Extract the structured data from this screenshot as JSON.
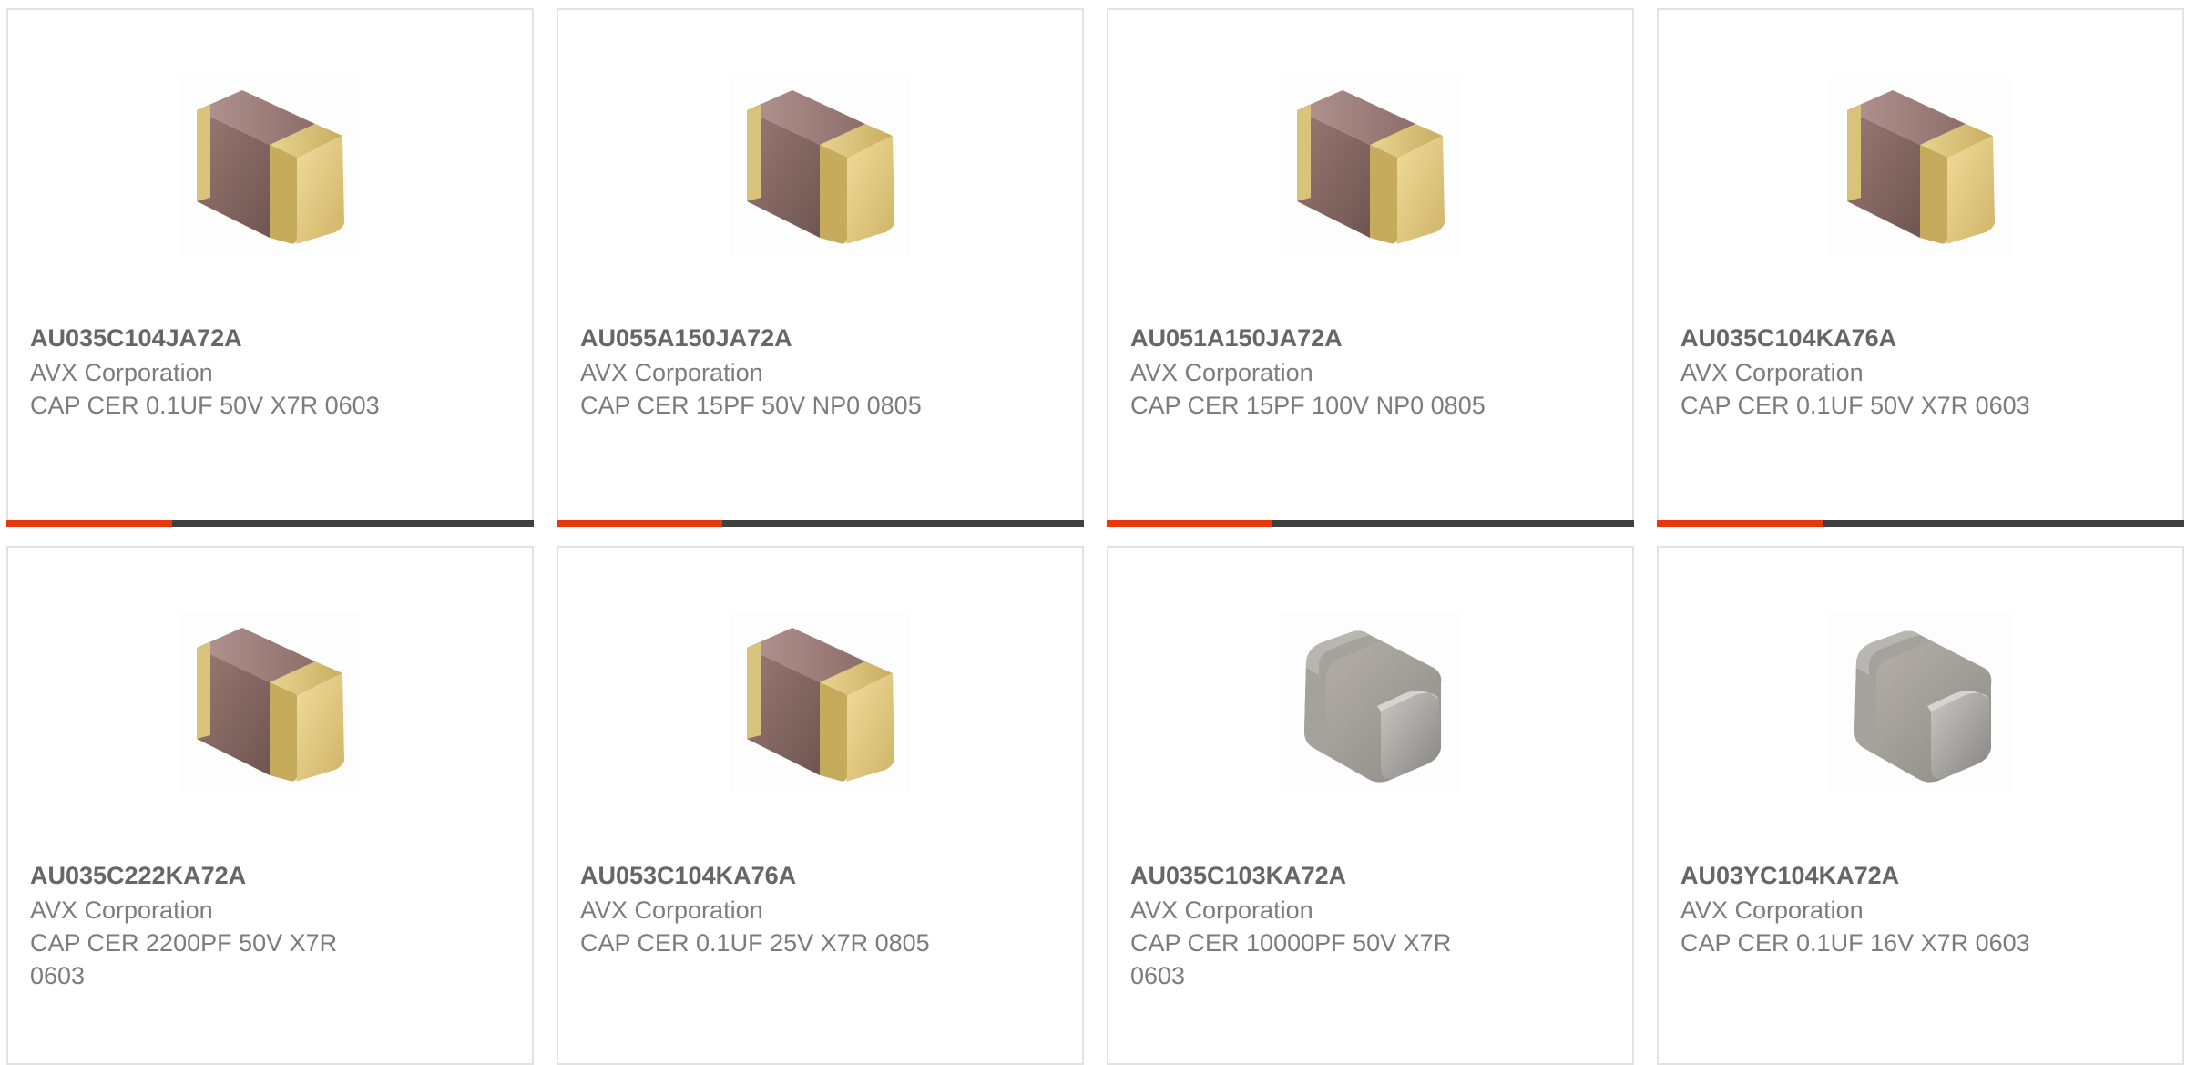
{
  "colors": {
    "accent_bar": "#e8360d",
    "dark_bar": "#404040",
    "border": "#e2e2e2",
    "part_text": "#666666",
    "body_text": "#7c7c7c"
  },
  "products": [
    {
      "part_number": "AU035C104JA72A",
      "manufacturer": "AVX Corporation",
      "description": "CAP CER 0.1UF 50V X7R 0603",
      "image": "capacitor-tan-icon",
      "show_bar": true
    },
    {
      "part_number": "AU055A150JA72A",
      "manufacturer": "AVX Corporation",
      "description": "CAP CER 15PF 50V NP0 0805",
      "image": "capacitor-tan-icon",
      "show_bar": true
    },
    {
      "part_number": "AU051A150JA72A",
      "manufacturer": "AVX Corporation",
      "description": "CAP CER 15PF 100V NP0 0805",
      "image": "capacitor-tan-icon",
      "show_bar": true
    },
    {
      "part_number": "AU035C104KA76A",
      "manufacturer": "AVX Corporation",
      "description": "CAP CER 0.1UF 50V X7R 0603",
      "image": "capacitor-tan-icon",
      "show_bar": true
    },
    {
      "part_number": "AU035C222KA72A",
      "manufacturer": "AVX Corporation",
      "description": "CAP CER 2200PF 50V X7R 0603",
      "image": "capacitor-tan-icon",
      "show_bar": false
    },
    {
      "part_number": "AU053C104KA76A",
      "manufacturer": "AVX Corporation",
      "description": "CAP CER 0.1UF 25V X7R 0805",
      "image": "capacitor-tan-icon",
      "show_bar": false
    },
    {
      "part_number": "AU035C103KA72A",
      "manufacturer": "AVX Corporation",
      "description": "CAP CER 10000PF 50V X7R 0603",
      "image": "capacitor-grey-icon",
      "show_bar": false
    },
    {
      "part_number": "AU03YC104KA72A",
      "manufacturer": "AVX Corporation",
      "description": "CAP CER 0.1UF 16V X7R 0603",
      "image": "capacitor-grey-icon",
      "show_bar": false
    }
  ]
}
